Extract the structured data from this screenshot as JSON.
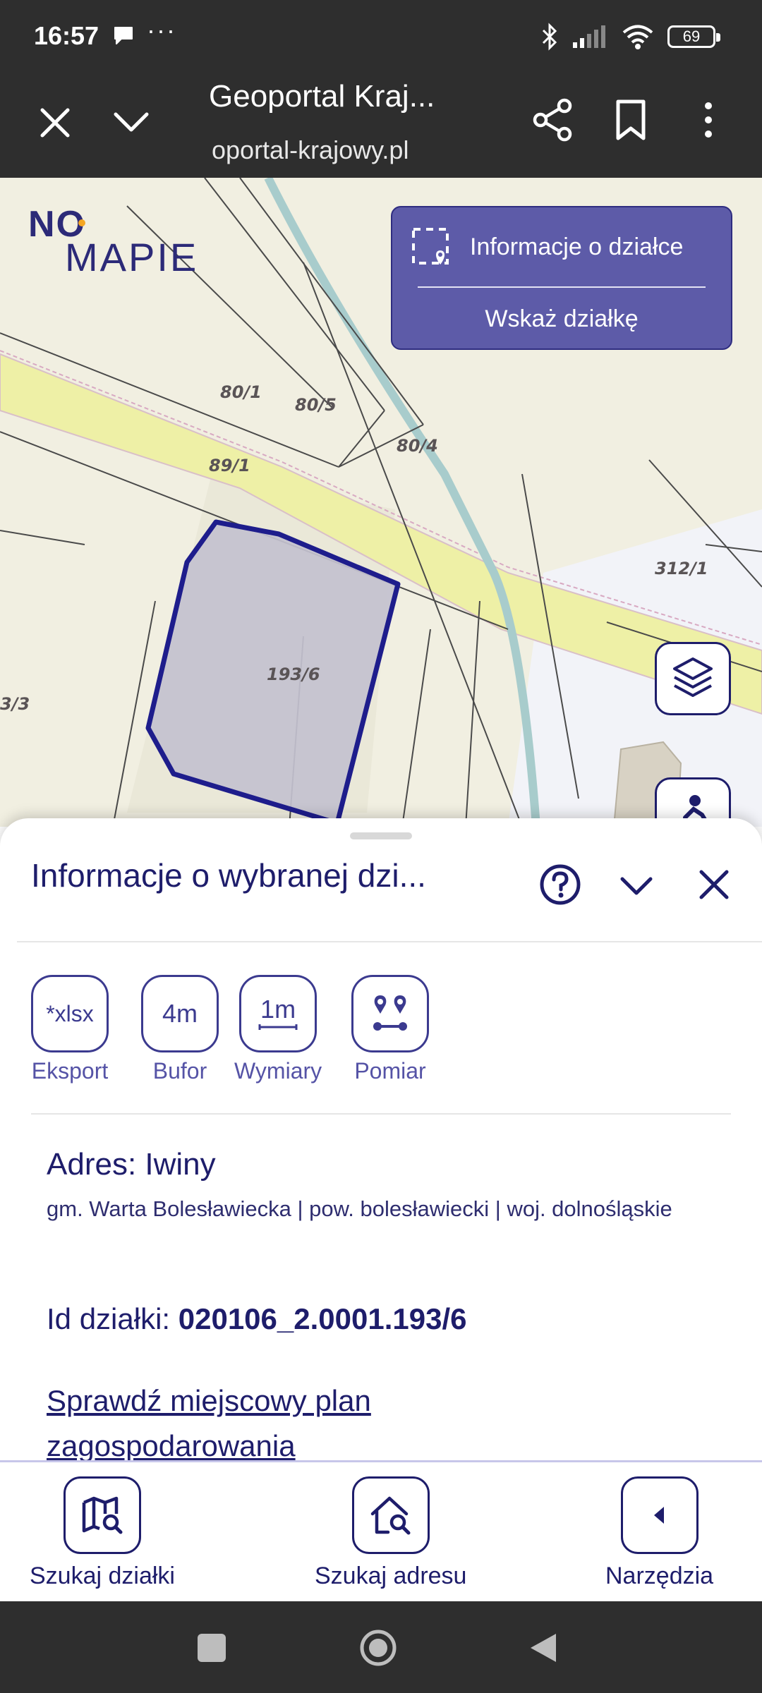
{
  "status_bar": {
    "time": "16:57",
    "dots": "···",
    "battery": "69",
    "icons": [
      "message-icon",
      "bluetooth-icon",
      "signal-icon",
      "wifi-icon",
      "battery-icon"
    ]
  },
  "browser": {
    "title": "Geoportal Kraj...",
    "url": "oportal-krajowy.pl"
  },
  "map": {
    "logo_no": "NO",
    "logo_mapie": "MAPIE",
    "parcel_labels": [
      "80/1",
      "80/5",
      "80/4",
      "89/1",
      "312/1",
      "193/6",
      "3/3"
    ],
    "panel": {
      "info_label": "Informacje o działce",
      "select_label": "Wskaż działkę"
    },
    "colors": {
      "panel": "#5d5ba8",
      "parcel_fill": "#c3c1cf",
      "parcel_border": "#1e1d8c",
      "road": "#eef0a6",
      "river": "#a8cccc"
    }
  },
  "sheet": {
    "title": "Informacje o wybranej dzi...",
    "tools": [
      {
        "icon_text": "*xlsx",
        "label": "Eksport"
      },
      {
        "icon_text": "4m",
        "label": "Bufor"
      },
      {
        "icon_text": "1m",
        "label": "Wymiary"
      },
      {
        "icon_text": "",
        "label": "Pomiar"
      }
    ],
    "address": "Adres: Iwiny",
    "address_sub": "gm. Warta Bolesławiecka | pow. bolesławiecki | woj. dolnośląskie",
    "parcel_id_label": "Id działki: ",
    "parcel_id_value": "020106_2.0001.193/6",
    "plan_link": "Sprawdź miejscowy plan zagospodarowania"
  },
  "bottom_nav": {
    "items": [
      {
        "label": "Szukaj działki"
      },
      {
        "label": "Szukaj adresu"
      },
      {
        "label": "Narzędzia"
      }
    ]
  }
}
